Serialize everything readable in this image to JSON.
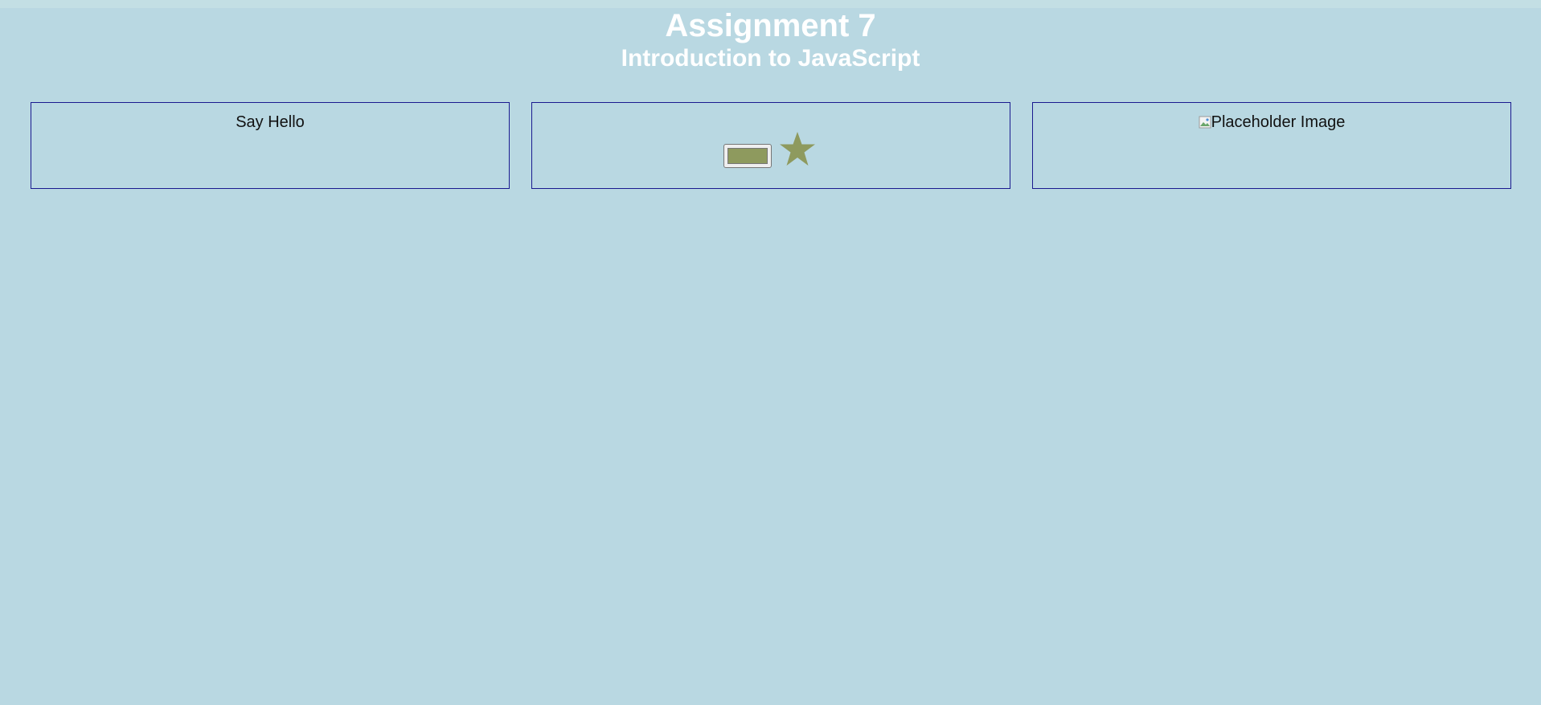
{
  "header": {
    "title": "Assignment 7",
    "subtitle": "Introduction to JavaScript"
  },
  "panels": {
    "hello": {
      "label": "Say Hello"
    },
    "color": {
      "value": "#8e9a5e",
      "star_color": "#8e9a5e",
      "icon": "star-icon"
    },
    "image": {
      "alt": "Placeholder Image",
      "icon": "broken-image-icon"
    }
  },
  "colors": {
    "background": "#b9d8e2",
    "panel_border": "#1a1a8f",
    "heading": "#ffffff"
  }
}
